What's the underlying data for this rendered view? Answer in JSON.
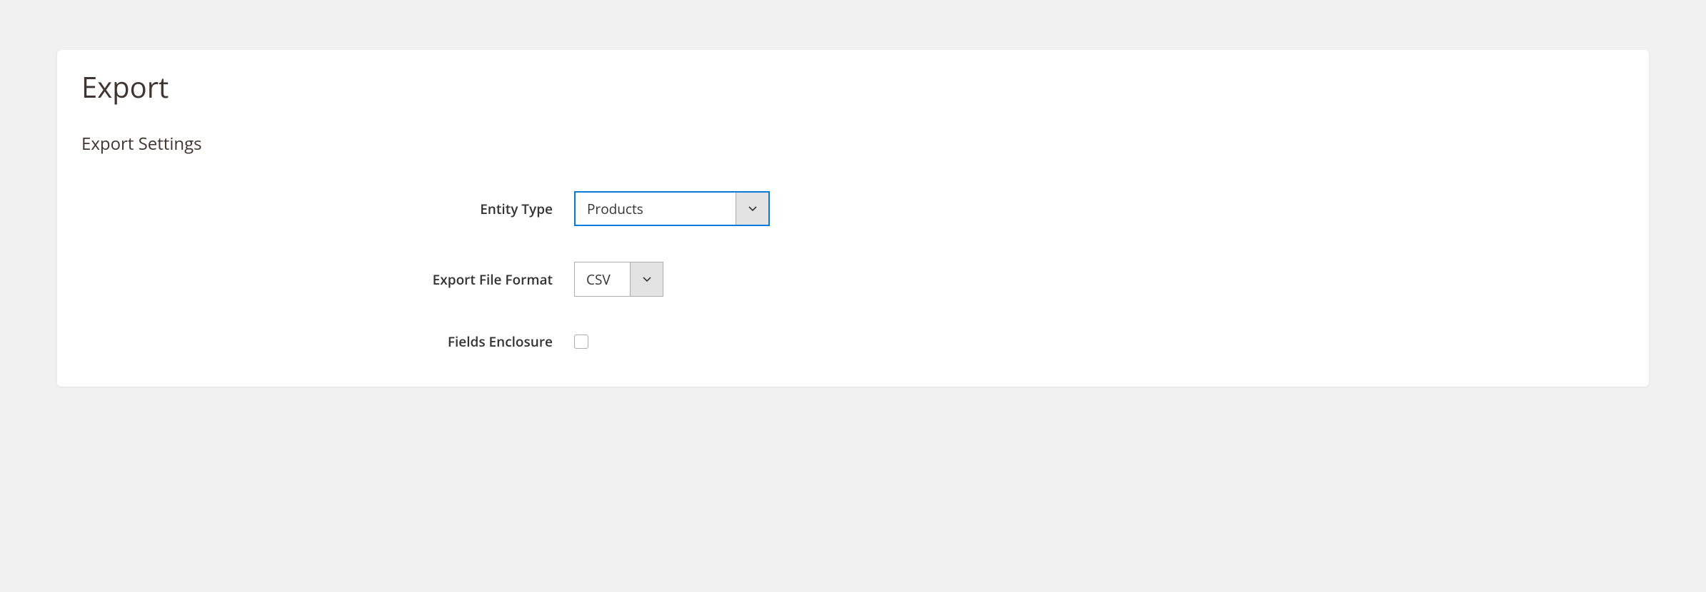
{
  "page": {
    "title": "Export",
    "section_title": "Export Settings"
  },
  "fields": {
    "entity_type": {
      "label": "Entity Type",
      "value": "Products"
    },
    "file_format": {
      "label": "Export File Format",
      "value": "CSV"
    },
    "fields_enclosure": {
      "label": "Fields Enclosure",
      "checked": false
    }
  }
}
